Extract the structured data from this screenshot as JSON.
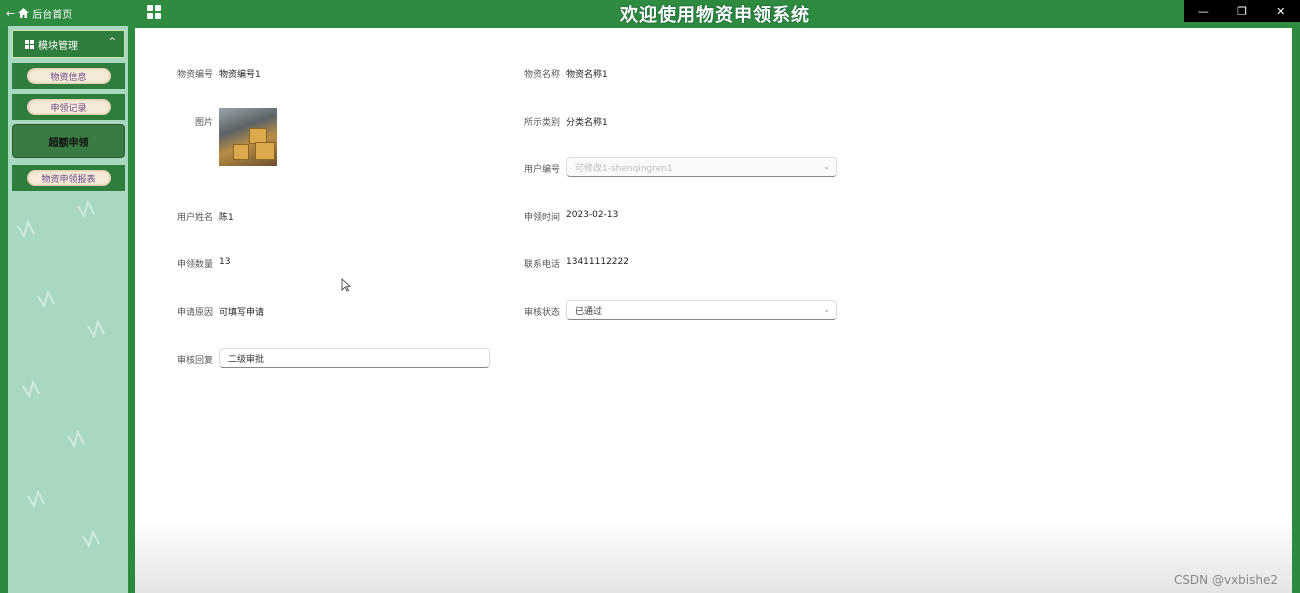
{
  "topbar": {
    "home_label": "后台首页",
    "title": "欢迎使用物资申领系统",
    "window_controls": [
      "—",
      "❐",
      "✕"
    ]
  },
  "sidebar": {
    "section_label": "模块管理",
    "items": [
      {
        "label": "物资信息"
      },
      {
        "label": "申领记录"
      },
      {
        "label": "超额申领"
      },
      {
        "label": "物资申领报表"
      }
    ]
  },
  "form": {
    "item_code": {
      "label": "物资编号",
      "value": "物资编号1"
    },
    "item_name": {
      "label": "物资名称",
      "value": "物资名称1"
    },
    "picture": {
      "label": "图片"
    },
    "category": {
      "label": "所示类别",
      "value": "分类名称1"
    },
    "user_id": {
      "label": "用户编号",
      "value": "可修改1-shenqingren1"
    },
    "user_name": {
      "label": "用户姓名",
      "value": "陈1"
    },
    "apply_time": {
      "label": "申领时间",
      "value": "2023-02-13"
    },
    "apply_qty": {
      "label": "申领数量",
      "value": "13"
    },
    "phone": {
      "label": "联系电话",
      "value": "13411112222"
    },
    "reason": {
      "label": "申请原因",
      "value": "可填写申请"
    },
    "audit_status": {
      "label": "审核状态",
      "value": "已通过"
    },
    "audit_reply": {
      "label": "审核回复",
      "value": "二级审批"
    }
  },
  "watermark": "CSDN @vxbishe2",
  "colors": {
    "accent": "#2e8b40",
    "sidebar": "#a8d8bf"
  }
}
